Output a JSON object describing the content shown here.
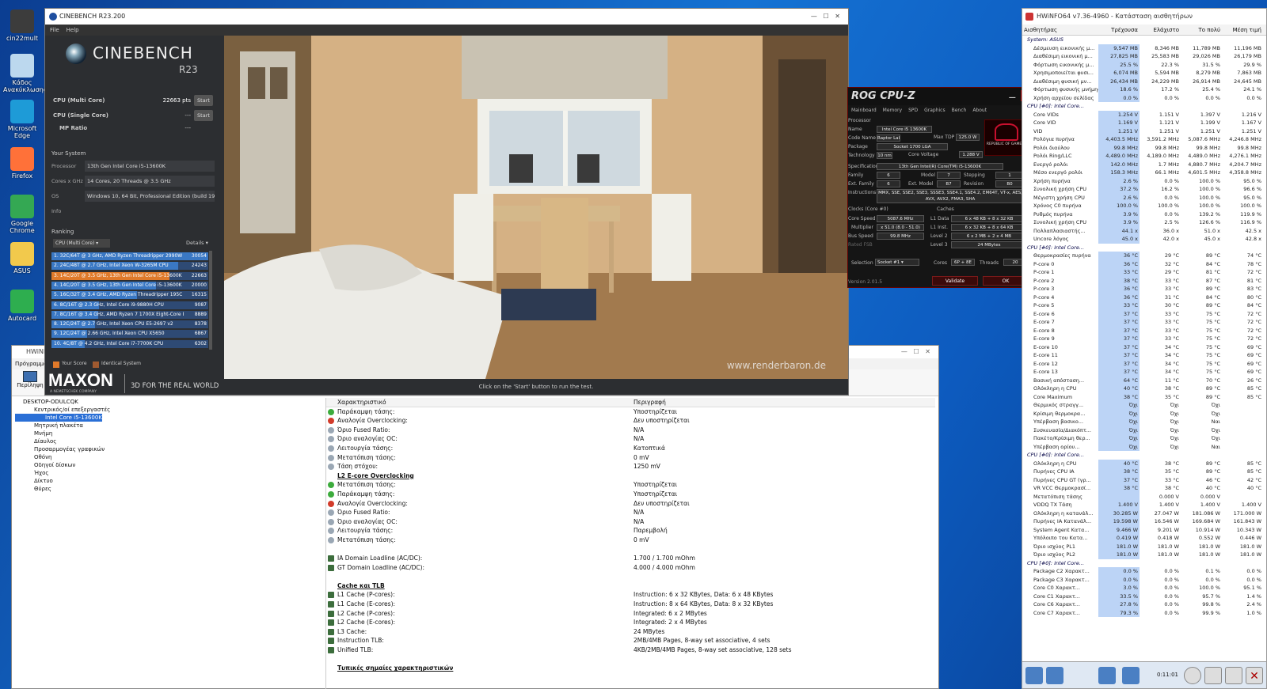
{
  "desktop": {
    "icons": [
      {
        "label": "cin22mult",
        "color": "#3c3c3c"
      },
      {
        "label": "Κάδος Ανακύκλωσης",
        "color": "#bcd8ee"
      },
      {
        "label": "Microsoft Edge",
        "color": "#1e9bd7"
      },
      {
        "label": "Firefox",
        "color": "#ff7139"
      },
      {
        "label": "Google Chrome",
        "color": "#34a853"
      },
      {
        "label": "ASUS",
        "color": "#f2c94c"
      },
      {
        "label": "Autocard",
        "color": "#2eae4f"
      }
    ]
  },
  "cinebench": {
    "title": "CINEBENCH R23.200",
    "menu": [
      "File",
      "Help"
    ],
    "brand": "CINEBENCH",
    "version": "R23",
    "multi_label": "CPU (Multi Core)",
    "multi_score": "22663 pts",
    "start": "Start",
    "single_label": "CPU (Single Core)",
    "single_score": "---",
    "mp_label": "MP Ratio",
    "mp_value": "---",
    "your_system": "Your System",
    "system": [
      {
        "label": "Processor",
        "value": "13th Gen Intel Core i5-13600K"
      },
      {
        "label": "Cores x GHz",
        "value": "14 Cores, 20 Threads @ 3.5 GHz"
      },
      {
        "label": "OS",
        "value": "Windows 10, 64 Bit, Professional Edition (build 19045"
      },
      {
        "label": "Info",
        "value": ""
      }
    ],
    "ranking": "Ranking",
    "ranking_select": "CPU (Multi Core)",
    "details": "Details",
    "ranks": [
      {
        "text": "1. 32C/64T @ 3 GHz, AMD Ryzen Threadripper 2990W",
        "score": "30054",
        "frac": 1.0,
        "mine": false
      },
      {
        "text": "2. 24C/48T @ 2.7 GHz, Intel Xeon W-3265M CPU",
        "score": "24243",
        "frac": 0.807,
        "mine": false
      },
      {
        "text": "3. 14C/20T @ 3.5 GHz, 13th Gen Intel Core i5-13600K",
        "score": "22663",
        "frac": 0.754,
        "mine": true
      },
      {
        "text": "4. 14C/20T @ 3.5 GHz, 13th Gen Intel Core i5-13600K",
        "score": "20000",
        "frac": 0.665,
        "mine": false
      },
      {
        "text": "5. 16C/32T @ 3.4 GHz, AMD Ryzen Threadripper 195C",
        "score": "16315",
        "frac": 0.543,
        "mine": false
      },
      {
        "text": "6. 8C/16T @ 2.3 GHz, Intel Core i9-9880H CPU",
        "score": "9087",
        "frac": 0.302,
        "mine": false
      },
      {
        "text": "7. 8C/16T @ 3.4 GHz, AMD Ryzen 7 1700X Eight-Core I",
        "score": "8889",
        "frac": 0.296,
        "mine": false
      },
      {
        "text": "8. 12C/24T @ 2.7 GHz, Intel Xeon CPU E5-2697 v2",
        "score": "8378",
        "frac": 0.279,
        "mine": false
      },
      {
        "text": "9. 12C/24T @ 2.66 GHz, Intel Xeon CPU X5650",
        "score": "6867",
        "frac": 0.228,
        "mine": false
      },
      {
        "text": "10. 4C/8T @ 4.2 GHz, Intel Core i7-7700K CPU",
        "score": "6302",
        "frac": 0.21,
        "mine": false
      }
    ],
    "your_score": "Your Score",
    "identical": "Identical System",
    "maxon": "MAXON",
    "maxon_sub": "A NEMETSCHEK COMPANY",
    "tagline": "3D FOR THE REAL WORLD",
    "watermark": "www.renderbaron.de",
    "status": "Click on the 'Start' button to run the test."
  },
  "cpuz": {
    "title": "ROG CPU-Z",
    "tabs": [
      "Mainboard",
      "Memory",
      "SPD",
      "Graphics",
      "Bench",
      "About"
    ],
    "processor_hdr": "Processor",
    "fields": [
      {
        "l": "Name",
        "v": "Intel Core i5 13600K"
      },
      {
        "l": "Code Name",
        "v": "Raptor Lake"
      },
      {
        "l": "Package",
        "v": "Socket 1700 LGA"
      },
      {
        "l": "Technology",
        "v": "10 nm"
      },
      {
        "l": "Specification",
        "v": "13th Gen Intel(R) Core(TM) i5-13600K"
      },
      {
        "l": "Family",
        "v": "6"
      },
      {
        "l": "Ext. Family",
        "v": "6"
      },
      {
        "l": "Instructions",
        "v": "MMX, SSE, SSE2, SSE3, SSSE3, SSE4.1, SSE4.2, EM64T, VT-x, AES, AVX, AVX2, FMA3, SHA"
      }
    ],
    "maxtdp_l": "Max TDP",
    "maxtdp": "125.0 W",
    "corev_l": "Core Voltage",
    "corev": "1.288 V",
    "model_l": "Model",
    "model": "7",
    "stepping_l": "Stepping",
    "stepping": "1",
    "extmodel_l": "Ext. Model",
    "extmodel": "B7",
    "revision_l": "Revision",
    "revision": "B0",
    "clocks_hdr": "Clocks (Core #0)",
    "corespeed_l": "Core Speed",
    "corespeed": "5087.6 MHz",
    "mult_l": "Multiplier",
    "mult": "x 51.0 (8.0 - 51.0)",
    "bus_l": "Bus Speed",
    "bus": "99.8 MHz",
    "fsb_l": "Rated FSB",
    "caches_hdr": "Caches",
    "l1d_l": "L1 Data",
    "l1d": "6 x 48 KB + 8 x 32 KB",
    "l1i_l": "L1 Inst.",
    "l1i": "6 x 32 KB + 8 x 64 KB",
    "l2_l": "Level 2",
    "l2": "6 x 2 MB + 2 x 4 MB",
    "l3_l": "Level 3",
    "l3": "24 MBytes",
    "sel_l": "Selection",
    "sel": "Socket #1",
    "cores_l": "Cores",
    "cores": "6P + 8E",
    "threads_l": "Threads",
    "threads": "20",
    "version": "Version 2.01.5",
    "validate": "Validate",
    "ok": "OK",
    "rog": "REPUBLIC OF GAMERS"
  },
  "hwsensors": {
    "title": "HWiNFO64 v7.36-4960 - Κατάσταση αισθητήρων",
    "headers": [
      "Αισθητήρας",
      "Τρέχουσα",
      "Ελάχιστο",
      "Το πολύ",
      "Μέση τιμή"
    ],
    "rows": [
      {
        "n": "System: ASUS",
        "c": "",
        "mn": "",
        "mx": "",
        "a": "",
        "grp": true
      },
      {
        "n": "Δέσμευση εικονικής μ...",
        "c": "9,547 MB",
        "mn": "8,346 MB",
        "mx": "11,789 MB",
        "a": "11,196 MB"
      },
      {
        "n": "Διαθέσιμη εικονική μ...",
        "c": "27,825 MB",
        "mn": "25,583 MB",
        "mx": "29,026 MB",
        "a": "26,179 MB"
      },
      {
        "n": "Φόρτωση εικονικής μ...",
        "c": "25.5 %",
        "mn": "22.3 %",
        "mx": "31.5 %",
        "a": "29.9 %"
      },
      {
        "n": "Χρησιμοποιείται φυσι...",
        "c": "6,074 MB",
        "mn": "5,594 MB",
        "mx": "8,279 MB",
        "a": "7,863 MB"
      },
      {
        "n": "Διαθέσιμη φυσική μν...",
        "c": "26,434 MB",
        "mn": "24,229 MB",
        "mx": "26,914 MB",
        "a": "24,645 MB"
      },
      {
        "n": "Φόρτωση φυσικής μνήμης",
        "c": "18.6 %",
        "mn": "17.2 %",
        "mx": "25.4 %",
        "a": "24.1 %"
      },
      {
        "n": "Χρήση αρχείου σελίδας",
        "c": "0.0 %",
        "mn": "0.0 %",
        "mx": "0.0 %",
        "a": "0.0 %"
      },
      {
        "n": "CPU [#0]: Intel Core...",
        "c": "",
        "mn": "",
        "mx": "",
        "a": "",
        "grp": true
      },
      {
        "n": "Core VIDs",
        "c": "1.254 V",
        "mn": "1.151 V",
        "mx": "1.397 V",
        "a": "1.216 V"
      },
      {
        "n": "Core VID",
        "c": "1.169 V",
        "mn": "1.121 V",
        "mx": "1.199 V",
        "a": "1.167 V"
      },
      {
        "n": "VID",
        "c": "1.251 V",
        "mn": "1.251 V",
        "mx": "1.251 V",
        "a": "1.251 V"
      },
      {
        "n": "Ρολόγια πυρήνα",
        "c": "4,403.5 MHz",
        "mn": "3,591.2 MHz",
        "mx": "5,087.6 MHz",
        "a": "4,246.8 MHz"
      },
      {
        "n": "Ρολόι διαύλου",
        "c": "99.8 MHz",
        "mn": "99.8 MHz",
        "mx": "99.8 MHz",
        "a": "99.8 MHz"
      },
      {
        "n": "Ρολόι Ring/LLC",
        "c": "4,489.0 MHz",
        "mn": "4,189.0 MHz",
        "mx": "4,489.0 MHz",
        "a": "4,276.1 MHz"
      },
      {
        "n": "Ενεργό ρολόι",
        "c": "142.0 MHz",
        "mn": "1.7 MHz",
        "mx": "4,880.7 MHz",
        "a": "4,204.7 MHz"
      },
      {
        "n": "Μέσο ενεργό ρολόι",
        "c": "158.3 MHz",
        "mn": "66.1 MHz",
        "mx": "4,601.5 MHz",
        "a": "4,358.8 MHz"
      },
      {
        "n": "Χρήση πυρήνα",
        "c": "2.6 %",
        "mn": "0.0 %",
        "mx": "100.0 %",
        "a": "95.0 %"
      },
      {
        "n": "Συνολική χρήση CPU",
        "c": "37.2 %",
        "mn": "16.2 %",
        "mx": "100.0 %",
        "a": "96.6 %"
      },
      {
        "n": "Μέγιστη χρήση CPU",
        "c": "2.6 %",
        "mn": "0.0 %",
        "mx": "100.0 %",
        "a": "95.0 %"
      },
      {
        "n": "Χρόνος C0 πυρήνα",
        "c": "100.0 %",
        "mn": "100.0 %",
        "mx": "100.0 %",
        "a": "100.0 %"
      },
      {
        "n": "Ρυθμός πυρήνα",
        "c": "3.9 %",
        "mn": "0.0 %",
        "mx": "139.2 %",
        "a": "119.9 %"
      },
      {
        "n": "Συνολική χρήση CPU",
        "c": "3.9 %",
        "mn": "2.5 %",
        "mx": "126.6 %",
        "a": "116.9 %"
      },
      {
        "n": "Πολλαπλασιαστής...",
        "c": "44.1 x",
        "mn": "36.0 x",
        "mx": "51.0 x",
        "a": "42.5 x"
      },
      {
        "n": "Uncore λόγος",
        "c": "45.0 x",
        "mn": "42.0 x",
        "mx": "45.0 x",
        "a": "42.8 x"
      },
      {
        "n": "CPU [#0]: Intel Core...",
        "c": "",
        "mn": "",
        "mx": "",
        "a": "",
        "grp": true
      },
      {
        "n": "Θερμοκρασίες πυρήνα",
        "c": "36 °C",
        "mn": "29 °C",
        "mx": "89 °C",
        "a": "74 °C"
      },
      {
        "n": "P-core 0",
        "c": "36 °C",
        "mn": "32 °C",
        "mx": "84 °C",
        "a": "78 °C"
      },
      {
        "n": "P-core 1",
        "c": "33 °C",
        "mn": "29 °C",
        "mx": "81 °C",
        "a": "72 °C"
      },
      {
        "n": "P-core 2",
        "c": "38 °C",
        "mn": "33 °C",
        "mx": "87 °C",
        "a": "81 °C"
      },
      {
        "n": "P-core 3",
        "c": "36 °C",
        "mn": "33 °C",
        "mx": "89 °C",
        "a": "83 °C"
      },
      {
        "n": "P-core 4",
        "c": "36 °C",
        "mn": "31 °C",
        "mx": "84 °C",
        "a": "80 °C"
      },
      {
        "n": "P-core 5",
        "c": "33 °C",
        "mn": "30 °C",
        "mx": "89 °C",
        "a": "84 °C"
      },
      {
        "n": "E-core 6",
        "c": "37 °C",
        "mn": "33 °C",
        "mx": "75 °C",
        "a": "72 °C"
      },
      {
        "n": "E-core 7",
        "c": "37 °C",
        "mn": "33 °C",
        "mx": "75 °C",
        "a": "72 °C"
      },
      {
        "n": "E-core 8",
        "c": "37 °C",
        "mn": "33 °C",
        "mx": "75 °C",
        "a": "72 °C"
      },
      {
        "n": "E-core 9",
        "c": "37 °C",
        "mn": "33 °C",
        "mx": "75 °C",
        "a": "72 °C"
      },
      {
        "n": "E-core 10",
        "c": "37 °C",
        "mn": "34 °C",
        "mx": "75 °C",
        "a": "69 °C"
      },
      {
        "n": "E-core 11",
        "c": "37 °C",
        "mn": "34 °C",
        "mx": "75 °C",
        "a": "69 °C"
      },
      {
        "n": "E-core 12",
        "c": "37 °C",
        "mn": "34 °C",
        "mx": "75 °C",
        "a": "69 °C"
      },
      {
        "n": "E-core 13",
        "c": "37 °C",
        "mn": "34 °C",
        "mx": "75 °C",
        "a": "69 °C"
      },
      {
        "n": "Βασική απόσταση...",
        "c": "64 °C",
        "mn": "11 °C",
        "mx": "70 °C",
        "a": "26 °C"
      },
      {
        "n": "Ολόκληρη η CPU",
        "c": "40 °C",
        "mn": "38 °C",
        "mx": "89 °C",
        "a": "85 °C"
      },
      {
        "n": "Core Maximum",
        "c": "38 °C",
        "mn": "35 °C",
        "mx": "89 °C",
        "a": "85 °C"
      },
      {
        "n": "Θερμικός στραγγ...",
        "c": "Όχι",
        "mn": "Όχι",
        "mx": "Όχι",
        "a": ""
      },
      {
        "n": "Κρίσιμη θερμοκρα...",
        "c": "Όχι",
        "mn": "Όχι",
        "mx": "Όχι",
        "a": ""
      },
      {
        "n": "Υπέρβαση βασικο...",
        "c": "Όχι",
        "mn": "Όχι",
        "mx": "Ναι",
        "a": ""
      },
      {
        "n": "Συσκευασία/Διακόπτ...",
        "c": "Όχι",
        "mn": "Όχι",
        "mx": "Όχι",
        "a": ""
      },
      {
        "n": "Πακέτο/Κρίσιμη θερ...",
        "c": "Όχι",
        "mn": "Όχι",
        "mx": "Όχι",
        "a": ""
      },
      {
        "n": "Υπέρβαση ορίου...",
        "c": "Όχι",
        "mn": "Όχι",
        "mx": "Ναι",
        "a": ""
      },
      {
        "n": "CPU [#0]: Intel Core...",
        "c": "",
        "mn": "",
        "mx": "",
        "a": "",
        "grp": true
      },
      {
        "n": "Ολόκληρη η CPU",
        "c": "40 °C",
        "mn": "38 °C",
        "mx": "89 °C",
        "a": "85 °C"
      },
      {
        "n": "Πυρήνες CPU IA",
        "c": "38 °C",
        "mn": "35 °C",
        "mx": "89 °C",
        "a": "85 °C"
      },
      {
        "n": "Πυρήνες CPU GT (γρ...",
        "c": "37 °C",
        "mn": "33 °C",
        "mx": "46 °C",
        "a": "42 °C"
      },
      {
        "n": "VR VCC Θερμοκρασί...",
        "c": "38 °C",
        "mn": "38 °C",
        "mx": "40 °C",
        "a": "40 °C"
      },
      {
        "n": "Μετατόπιση τάσης",
        "c": "",
        "mn": "0.000 V",
        "mx": "0.000 V",
        "a": ""
      },
      {
        "n": "VDDQ TX Τάση",
        "c": "1.400 V",
        "mn": "1.400 V",
        "mx": "1.400 V",
        "a": "1.400 V"
      },
      {
        "n": "Ολόκληρη η κατανάλ...",
        "c": "30.285 W",
        "mn": "27.047 W",
        "mx": "181.086 W",
        "a": "171.000 W"
      },
      {
        "n": "Πυρήνες IA Κατανάλ...",
        "c": "19.598 W",
        "mn": "16.546 W",
        "mx": "169.684 W",
        "a": "161.843 W"
      },
      {
        "n": "System Agent Κατα...",
        "c": "9.466 W",
        "mn": "9.201 W",
        "mx": "10.914 W",
        "a": "10.343 W"
      },
      {
        "n": "Υπόλοιπο του Κατα...",
        "c": "0.419 W",
        "mn": "0.418 W",
        "mx": "0.552 W",
        "a": "0.446 W"
      },
      {
        "n": "Όριο ισχύος PL1",
        "c": "181.0 W",
        "mn": "181.0 W",
        "mx": "181.0 W",
        "a": "181.0 W"
      },
      {
        "n": "Όριο ισχύος PL2",
        "c": "181.0 W",
        "mn": "181.0 W",
        "mx": "181.0 W",
        "a": "181.0 W"
      },
      {
        "n": "CPU [#0]: Intel Core...",
        "c": "",
        "mn": "",
        "mx": "",
        "a": "",
        "grp": true
      },
      {
        "n": "Package C2 Χαρακτ...",
        "c": "0.0 %",
        "mn": "0.0 %",
        "mx": "0.1 %",
        "a": "0.0 %"
      },
      {
        "n": "Package C3 Χαρακτ...",
        "c": "0.0 %",
        "mn": "0.0 %",
        "mx": "0.0 %",
        "a": "0.0 %"
      },
      {
        "n": "Core C0 Χαρακτ...",
        "c": "3.0 %",
        "mn": "0.0 %",
        "mx": "100.0 %",
        "a": "95.1 %"
      },
      {
        "n": "Core C1 Χαρακτ...",
        "c": "33.5 %",
        "mn": "0.0 %",
        "mx": "95.7 %",
        "a": "1.4 %"
      },
      {
        "n": "Core C6 Χαρακτ...",
        "c": "27.8 %",
        "mn": "0.0 %",
        "mx": "99.8 %",
        "a": "2.4 %"
      },
      {
        "n": "Core C7 Χαρακτ...",
        "c": "79.3 %",
        "mn": "0.0 %",
        "mx": "99.9 %",
        "a": "1.0 %"
      }
    ],
    "timer": "0:11:01"
  },
  "hwsys": {
    "title": "HWiNFO",
    "menu": "Πρόγραμμα",
    "summary": "Περίληψη",
    "tree": [
      "DESKTOP-ODULCQK",
      "Κεντρικός/οί επεξεργαστές",
      "Intel Core i5-13600K",
      "Μητρική πλακέτα",
      "Μνήμη",
      "Δίαυλος",
      "Προσαρμογέας γραφικών",
      "Οθόνη",
      "Οδηγοί δίσκων",
      "Ήχος",
      "Δίκτυο",
      "Θύρες"
    ],
    "col_feature": "Χαρακτηριστικό",
    "col_desc": "Περιγραφή",
    "rows": [
      {
        "k": "Παράκαμψη τάσης:",
        "v": "Υποστηρίζεται",
        "s": "ok"
      },
      {
        "k": "Αναλογία Overclocking:",
        "v": "Δεν υποστηρίζεται",
        "s": "no"
      },
      {
        "k": "Όριο Fused Ratio:",
        "v": "N/A",
        "s": "n"
      },
      {
        "k": "Όριο αναλογίας OC:",
        "v": "N/A",
        "s": "n"
      },
      {
        "k": "Λειτουργία τάσης:",
        "v": "Κατοπτικά",
        "s": "n"
      },
      {
        "k": "Μετατόπιση τάσης:",
        "v": "0 mV",
        "s": "n"
      },
      {
        "k": "Τάση στόχου:",
        "v": "1250 mV",
        "s": "n"
      },
      {
        "k": "L2 E-core Overclocking",
        "v": "",
        "s": "sec"
      },
      {
        "k": "Μετατόπιση τάσης:",
        "v": "Υποστηρίζεται",
        "s": "ok"
      },
      {
        "k": "Παράκαμψη τάσης:",
        "v": "Υποστηρίζεται",
        "s": "ok"
      },
      {
        "k": "Αναλογία Overclocking:",
        "v": "Δεν υποστηρίζεται",
        "s": "no"
      },
      {
        "k": "Όριο Fused Ratio:",
        "v": "N/A",
        "s": "n"
      },
      {
        "k": "Όριο αναλογίας OC:",
        "v": "N/A",
        "s": "n"
      },
      {
        "k": "Λειτουργία τάσης:",
        "v": "Παρεμβολή",
        "s": "n"
      },
      {
        "k": "Μετατόπιση τάσης:",
        "v": "0 mV",
        "s": "n"
      },
      {
        "k": "",
        "v": "",
        "s": "blank"
      },
      {
        "k": "IA Domain Loadline (AC/DC):",
        "v": "1.700 / 1.700 mOhm",
        "s": "sq"
      },
      {
        "k": "GT Domain Loadline (AC/DC):",
        "v": "4.000 / 4.000 mOhm",
        "s": "sq"
      },
      {
        "k": "",
        "v": "",
        "s": "blank"
      },
      {
        "k": "Cache και TLB",
        "v": "",
        "s": "sec"
      },
      {
        "k": "L1 Cache (P-cores):",
        "v": "Instruction: 6 x 32 KBytes, Data: 6 x 48 KBytes",
        "s": "sq"
      },
      {
        "k": "L1 Cache (E-cores):",
        "v": "Instruction: 8 x 64 KBytes, Data: 8 x 32 KBytes",
        "s": "sq"
      },
      {
        "k": "L2 Cache (P-cores):",
        "v": "Integrated: 6 x 2 MBytes",
        "s": "sq"
      },
      {
        "k": "L2 Cache (E-cores):",
        "v": "Integrated: 2 x 4 MBytes",
        "s": "sq"
      },
      {
        "k": "L3 Cache:",
        "v": "24 MBytes",
        "s": "sq"
      },
      {
        "k": "Instruction TLB:",
        "v": "2MB/4MB Pages, 8-way set associative, 4 sets",
        "s": "sq"
      },
      {
        "k": "Unified TLB:",
        "v": "4KB/2MB/4MB Pages, 8-way set associative, 128 sets",
        "s": "sq"
      },
      {
        "k": "",
        "v": "",
        "s": "blank"
      },
      {
        "k": "Τυπικές σημαίες χαρακτηριστικών",
        "v": "",
        "s": "sec"
      }
    ]
  },
  "colors": {
    "accent": "#3a78c4",
    "mine": "#e07a2a",
    "rog": "#c8102e"
  }
}
